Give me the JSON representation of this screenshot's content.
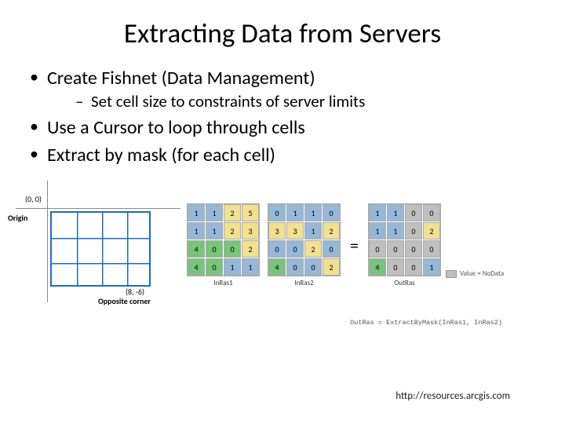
{
  "title": "Extracting Data from Servers",
  "bullets": {
    "b1": "Create Fishnet (Data Management)",
    "b1_sub": "Set cell size to constraints of server limits",
    "b2": "Use a Cursor to loop through cells",
    "b3": "Extract by mask (for each cell)"
  },
  "fishnet": {
    "origin_coord": "(0, 0)",
    "origin_label": "Origin",
    "opp_coord": "(8, -6)",
    "opp_label": "Opposite corner"
  },
  "chart_data": {
    "type": "table",
    "title": "Extract by Mask raster illustration",
    "grids": [
      {
        "name": "InRas1",
        "rows": [
          [
            1,
            1,
            2,
            5
          ],
          [
            1,
            1,
            2,
            3
          ],
          [
            4,
            0,
            0,
            2
          ],
          [
            4,
            0,
            1,
            1
          ]
        ],
        "colors": [
          [
            "blue",
            "blue",
            "yellow",
            "yellow"
          ],
          [
            "blue",
            "blue",
            "yellow",
            "yellow"
          ],
          [
            "green",
            "green",
            "green",
            "yellow"
          ],
          [
            "green",
            "green",
            "blue",
            "blue"
          ]
        ]
      },
      {
        "name": "InRas2",
        "rows": [
          [
            0,
            1,
            1,
            0
          ],
          [
            3,
            3,
            1,
            2
          ],
          [
            0,
            0,
            2,
            0
          ],
          [
            4,
            0,
            0,
            2
          ]
        ],
        "colors": [
          [
            "blue",
            "blue",
            "blue",
            "blue"
          ],
          [
            "yellow",
            "yellow",
            "blue",
            "yellow"
          ],
          [
            "blue",
            "blue",
            "yellow",
            "blue"
          ],
          [
            "green",
            "blue",
            "blue",
            "yellow"
          ]
        ]
      },
      {
        "name": "OutRas",
        "rows": [
          [
            1,
            1,
            0,
            0
          ],
          [
            1,
            1,
            0,
            2
          ],
          [
            0,
            0,
            0,
            0
          ],
          [
            4,
            0,
            0,
            1
          ]
        ],
        "colors": [
          [
            "blue",
            "blue",
            "gray",
            "gray"
          ],
          [
            "blue",
            "blue",
            "gray",
            "yellow"
          ],
          [
            "gray",
            "gray",
            "gray",
            "gray"
          ],
          [
            "green",
            "gray",
            "gray",
            "blue"
          ]
        ]
      }
    ],
    "legend": "Value = NoData",
    "code": "OutRas = ExtractByMask(InRas1, InRas2)"
  },
  "footer": "http://resources.arcgis.com"
}
